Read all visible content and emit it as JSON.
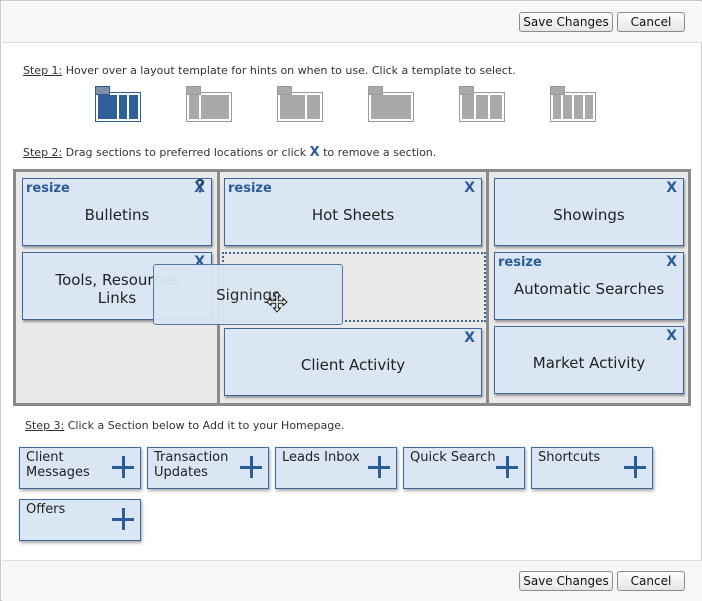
{
  "toolbar": {
    "save_label": "Save Changes",
    "cancel_label": "Cancel"
  },
  "step1": {
    "prefix": "Step 1:",
    "text": " Hover over a layout template for hints on when to use. Click a template to select."
  },
  "step2": {
    "prefix": "Step 2:",
    "text_before": " Drag sections to preferred locations or click ",
    "x_symbol": "X",
    "text_after": " to remove a section."
  },
  "step3": {
    "prefix": "Step 3:",
    "text": " Click a Section below to Add it to your Homepage."
  },
  "templates": [
    "one-wide-two-narrow",
    "two-column",
    "two-column-split",
    "one-column",
    "three-column",
    "four-column"
  ],
  "sections": {
    "bulletins": {
      "title": "Bulletins",
      "resize": "resize",
      "remove": "X"
    },
    "tools": {
      "title_line1": "Tools, Resources",
      "title_line2": "Links",
      "remove": "X"
    },
    "hot_sheets": {
      "title": "Hot Sheets",
      "resize": "resize",
      "remove": "X"
    },
    "client_activity": {
      "title": "Client Activity",
      "remove": "X"
    },
    "showings": {
      "title": "Showings",
      "remove": "X"
    },
    "automatic_searches": {
      "title": "Automatic Searches",
      "resize": "resize",
      "remove": "X"
    },
    "market_activity": {
      "title": "Market Activity",
      "remove": "X"
    }
  },
  "dragging": {
    "title": "Signings"
  },
  "available": [
    {
      "line1": "Client",
      "line2": "Messages"
    },
    {
      "line1": "Transaction",
      "line2": "Updates"
    },
    {
      "line1": "Leads Inbox",
      "line2": ""
    },
    {
      "line1": "Quick Search",
      "line2": ""
    },
    {
      "line1": "Shortcuts",
      "line2": ""
    },
    {
      "line1": "Offers",
      "line2": ""
    }
  ],
  "colors": {
    "accent": "#2a5c9a",
    "section_bg": "#dbe6f4",
    "section_border": "#3e6797",
    "layout_border": "#8a8a8a"
  }
}
